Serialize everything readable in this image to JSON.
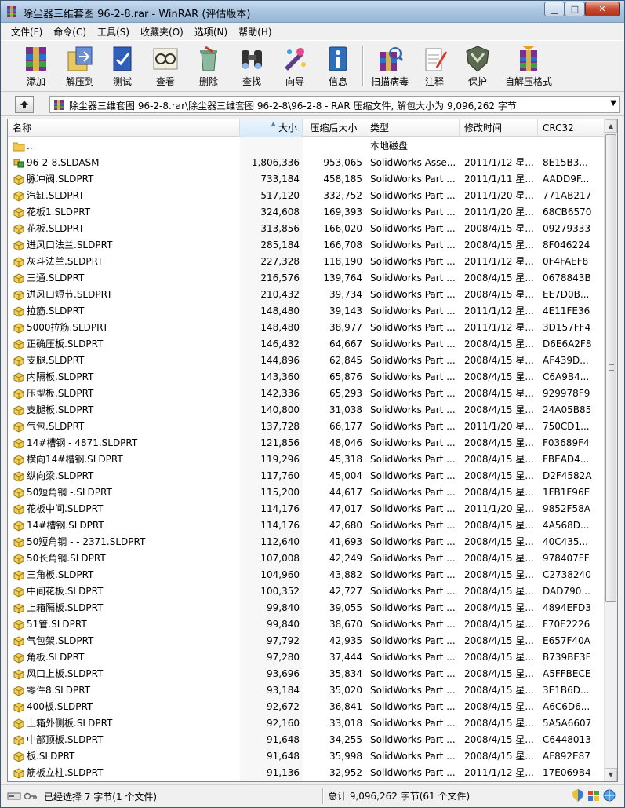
{
  "window": {
    "title": "除尘器三维套图 96-2-8.rar - WinRAR (评估版本)",
    "colors": {
      "accent": "#3399ff",
      "folder": "#f2c94c",
      "titlebar": "#a9c4e0"
    }
  },
  "menu": [
    "文件(F)",
    "命令(C)",
    "工具(S)",
    "收藏夹(O)",
    "选项(N)",
    "帮助(H)"
  ],
  "toolbar": [
    {
      "label": "添加",
      "icon": "archive-add-icon"
    },
    {
      "label": "解压到",
      "icon": "extract-to-icon"
    },
    {
      "label": "测试",
      "icon": "test-icon"
    },
    {
      "label": "查看",
      "icon": "view-icon"
    },
    {
      "label": "删除",
      "icon": "delete-icon"
    },
    {
      "label": "查找",
      "icon": "find-icon"
    },
    {
      "label": "向导",
      "icon": "wizard-icon"
    },
    {
      "label": "信息",
      "icon": "info-icon"
    },
    {
      "label": "扫描病毒",
      "icon": "virus-scan-icon"
    },
    {
      "label": "注释",
      "icon": "comment-icon"
    },
    {
      "label": "保护",
      "icon": "protect-icon"
    },
    {
      "label": "自解压格式",
      "icon": "sfx-icon"
    }
  ],
  "address": {
    "path": "除尘器三维套图 96-2-8.rar\\除尘器三维套图 96-2-8\\96-2-8 - RAR 压缩文件, 解包大小为 9,096,262 字节"
  },
  "columns": {
    "name": "名称",
    "size": "大小",
    "packed": "压缩后大小",
    "type": "类型",
    "modified": "修改时间",
    "crc": "CRC32"
  },
  "files": [
    {
      "name": "..",
      "size": "",
      "packed": "",
      "type": "本地磁盘",
      "modified": "",
      "crc": "",
      "icon": "folder-icon"
    },
    {
      "name": "96-2-8.SLDASM",
      "size": "1,806,336",
      "packed": "953,065",
      "type": "SolidWorks Asse...",
      "modified": "2011/1/12 星...",
      "crc": "8E15B3...",
      "icon": "assembly-icon"
    },
    {
      "name": "脉冲阀.SLDPRT",
      "size": "733,184",
      "packed": "458,185",
      "type": "SolidWorks Part ...",
      "modified": "2011/1/11 星...",
      "crc": "AADD9F...",
      "icon": "part-icon"
    },
    {
      "name": "汽缸.SLDPRT",
      "size": "517,120",
      "packed": "332,752",
      "type": "SolidWorks Part ...",
      "modified": "2011/1/20 星...",
      "crc": "771AB217",
      "icon": "part-icon"
    },
    {
      "name": "花板1.SLDPRT",
      "size": "324,608",
      "packed": "169,393",
      "type": "SolidWorks Part ...",
      "modified": "2011/1/20 星...",
      "crc": "68CB6570",
      "icon": "part-icon"
    },
    {
      "name": "花板.SLDPRT",
      "size": "313,856",
      "packed": "166,020",
      "type": "SolidWorks Part ...",
      "modified": "2008/4/15 星...",
      "crc": "09279333",
      "icon": "part-icon"
    },
    {
      "name": "进风口法兰.SLDPRT",
      "size": "285,184",
      "packed": "166,708",
      "type": "SolidWorks Part ...",
      "modified": "2008/4/15 星...",
      "crc": "8F046224",
      "icon": "part-icon"
    },
    {
      "name": "灰斗法兰.SLDPRT",
      "size": "227,328",
      "packed": "118,190",
      "type": "SolidWorks Part ...",
      "modified": "2011/1/12 星...",
      "crc": "0F4FAEF8",
      "icon": "part-icon"
    },
    {
      "name": "三通.SLDPRT",
      "size": "216,576",
      "packed": "139,764",
      "type": "SolidWorks Part ...",
      "modified": "2008/4/15 星...",
      "crc": "0678843B",
      "icon": "part-icon"
    },
    {
      "name": "进风口短节.SLDPRT",
      "size": "210,432",
      "packed": "39,734",
      "type": "SolidWorks Part ...",
      "modified": "2008/4/15 星...",
      "crc": "EE7D0B...",
      "icon": "part-icon"
    },
    {
      "name": "拉筋.SLDPRT",
      "size": "148,480",
      "packed": "39,143",
      "type": "SolidWorks Part ...",
      "modified": "2011/1/12 星...",
      "crc": "4E11FE36",
      "icon": "part-icon"
    },
    {
      "name": "5000拉筋.SLDPRT",
      "size": "148,480",
      "packed": "38,977",
      "type": "SolidWorks Part ...",
      "modified": "2011/1/12 星...",
      "crc": "3D157FF4",
      "icon": "part-icon"
    },
    {
      "name": "正确压板.SLDPRT",
      "size": "146,432",
      "packed": "64,667",
      "type": "SolidWorks Part ...",
      "modified": "2008/4/15 星...",
      "crc": "D6E6A2F8",
      "icon": "part-icon"
    },
    {
      "name": "支腿.SLDPRT",
      "size": "144,896",
      "packed": "62,845",
      "type": "SolidWorks Part ...",
      "modified": "2008/4/15 星...",
      "crc": "AF439D...",
      "icon": "part-icon"
    },
    {
      "name": "内隔板.SLDPRT",
      "size": "143,360",
      "packed": "65,876",
      "type": "SolidWorks Part ...",
      "modified": "2008/4/15 星...",
      "crc": "C6A9B4...",
      "icon": "part-icon"
    },
    {
      "name": "压型板.SLDPRT",
      "size": "142,336",
      "packed": "65,293",
      "type": "SolidWorks Part ...",
      "modified": "2008/4/15 星...",
      "crc": "929978F9",
      "icon": "part-icon"
    },
    {
      "name": "支腿板.SLDPRT",
      "size": "140,800",
      "packed": "31,038",
      "type": "SolidWorks Part ...",
      "modified": "2008/4/15 星...",
      "crc": "24A05B85",
      "icon": "part-icon"
    },
    {
      "name": "气包.SLDPRT",
      "size": "137,728",
      "packed": "66,177",
      "type": "SolidWorks Part ...",
      "modified": "2011/1/20 星...",
      "crc": "750CD1...",
      "icon": "part-icon"
    },
    {
      "name": "14#槽钢 - 4871.SLDPRT",
      "size": "121,856",
      "packed": "48,046",
      "type": "SolidWorks Part ...",
      "modified": "2008/4/15 星...",
      "crc": "F03689F4",
      "icon": "part-icon"
    },
    {
      "name": "横向14#槽钢.SLDPRT",
      "size": "119,296",
      "packed": "45,318",
      "type": "SolidWorks Part ...",
      "modified": "2008/4/15 星...",
      "crc": "FBEAD4...",
      "icon": "part-icon"
    },
    {
      "name": "纵向梁.SLDPRT",
      "size": "117,760",
      "packed": "45,004",
      "type": "SolidWorks Part ...",
      "modified": "2008/4/15 星...",
      "crc": "D2F4582A",
      "icon": "part-icon"
    },
    {
      "name": "50短角钢 -.SLDPRT",
      "size": "115,200",
      "packed": "44,617",
      "type": "SolidWorks Part ...",
      "modified": "2008/4/15 星...",
      "crc": "1FB1F96E",
      "icon": "part-icon"
    },
    {
      "name": "花板中间.SLDPRT",
      "size": "114,176",
      "packed": "47,017",
      "type": "SolidWorks Part ...",
      "modified": "2011/1/20 星...",
      "crc": "9852F58A",
      "icon": "part-icon"
    },
    {
      "name": "14#槽钢.SLDPRT",
      "size": "114,176",
      "packed": "42,680",
      "type": "SolidWorks Part ...",
      "modified": "2008/4/15 星...",
      "crc": "4A568D...",
      "icon": "part-icon"
    },
    {
      "name": "50短角钢 - - 2371.SLDPRT",
      "size": "112,640",
      "packed": "41,693",
      "type": "SolidWorks Part ...",
      "modified": "2008/4/15 星...",
      "crc": "40C435...",
      "icon": "part-icon"
    },
    {
      "name": "50长角钢.SLDPRT",
      "size": "107,008",
      "packed": "42,249",
      "type": "SolidWorks Part ...",
      "modified": "2008/4/15 星...",
      "crc": "978407FF",
      "icon": "part-icon"
    },
    {
      "name": "三角板.SLDPRT",
      "size": "104,960",
      "packed": "43,882",
      "type": "SolidWorks Part ...",
      "modified": "2008/4/15 星...",
      "crc": "C2738240",
      "icon": "part-icon"
    },
    {
      "name": "中间花板.SLDPRT",
      "size": "100,352",
      "packed": "42,727",
      "type": "SolidWorks Part ...",
      "modified": "2008/4/15 星...",
      "crc": "DAD790...",
      "icon": "part-icon"
    },
    {
      "name": "上箱隔板.SLDPRT",
      "size": "99,840",
      "packed": "39,055",
      "type": "SolidWorks Part ...",
      "modified": "2008/4/15 星...",
      "crc": "4894EFD3",
      "icon": "part-icon"
    },
    {
      "name": "51管.SLDPRT",
      "size": "99,840",
      "packed": "38,670",
      "type": "SolidWorks Part ...",
      "modified": "2008/4/15 星...",
      "crc": "F70E2226",
      "icon": "part-icon"
    },
    {
      "name": "气包架.SLDPRT",
      "size": "97,792",
      "packed": "42,935",
      "type": "SolidWorks Part ...",
      "modified": "2008/4/15 星...",
      "crc": "E657F40A",
      "icon": "part-icon"
    },
    {
      "name": "角板.SLDPRT",
      "size": "97,280",
      "packed": "37,444",
      "type": "SolidWorks Part ...",
      "modified": "2008/4/15 星...",
      "crc": "B739BE3F",
      "icon": "part-icon"
    },
    {
      "name": "风口上板.SLDPRT",
      "size": "93,696",
      "packed": "35,834",
      "type": "SolidWorks Part ...",
      "modified": "2008/4/15 星...",
      "crc": "A5FFBECE",
      "icon": "part-icon"
    },
    {
      "name": "零件8.SLDPRT",
      "size": "93,184",
      "packed": "35,020",
      "type": "SolidWorks Part ...",
      "modified": "2008/4/15 星...",
      "crc": "3E1B6D...",
      "icon": "part-icon"
    },
    {
      "name": "400板.SLDPRT",
      "size": "92,672",
      "packed": "36,841",
      "type": "SolidWorks Part ...",
      "modified": "2008/4/15 星...",
      "crc": "A6C6D6...",
      "icon": "part-icon"
    },
    {
      "name": "上箱外侧板.SLDPRT",
      "size": "92,160",
      "packed": "33,018",
      "type": "SolidWorks Part ...",
      "modified": "2008/4/15 星...",
      "crc": "5A5A6607",
      "icon": "part-icon"
    },
    {
      "name": "中部顶板.SLDPRT",
      "size": "91,648",
      "packed": "34,255",
      "type": "SolidWorks Part ...",
      "modified": "2008/4/15 星...",
      "crc": "C6448013",
      "icon": "part-icon"
    },
    {
      "name": "板.SLDPRT",
      "size": "91,648",
      "packed": "35,998",
      "type": "SolidWorks Part ...",
      "modified": "2008/4/15 星...",
      "crc": "AF892E87",
      "icon": "part-icon"
    },
    {
      "name": "筋板立柱.SLDPRT",
      "size": "91,136",
      "packed": "32,952",
      "type": "SolidWorks Part ...",
      "modified": "2011/1/12 星...",
      "crc": "17E069B4",
      "icon": "part-icon"
    }
  ],
  "status": {
    "left": "已经选择 7 字节(1 个文件)",
    "right": "总计 9,096,262 字节(61 个文件)"
  }
}
